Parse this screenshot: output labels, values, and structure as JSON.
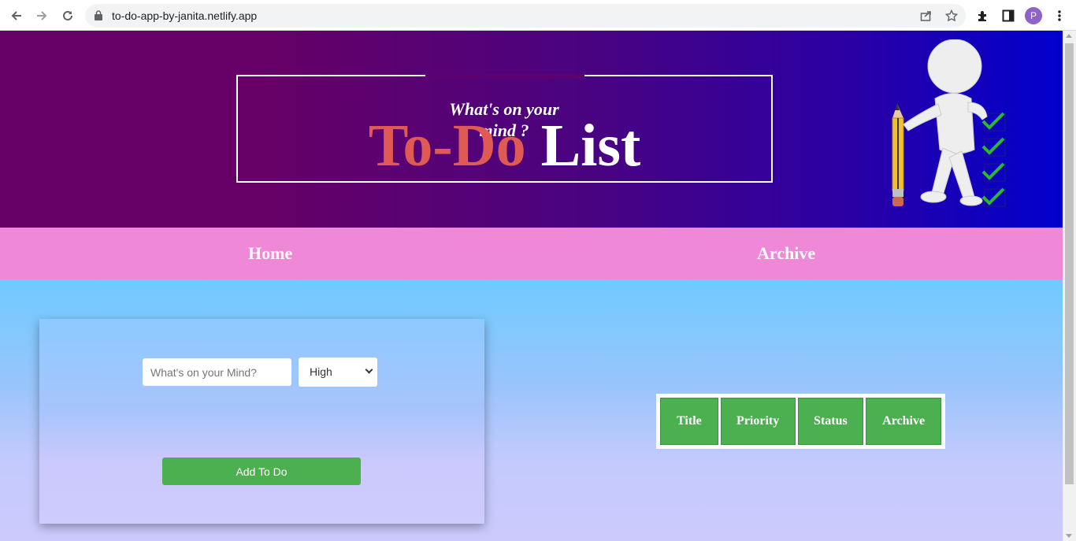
{
  "browser": {
    "url": "to-do-app-by-janita.netlify.app",
    "profile_initial": "P",
    "back_icon": "arrow-left-icon",
    "forward_icon": "arrow-right-icon",
    "reload_icon": "reload-icon"
  },
  "header": {
    "tagline_line1": "What's on your",
    "tagline_line2": "mind ?",
    "title_part1": "To-Do",
    "title_part2": "List",
    "colors": {
      "gradient_start": "#660066",
      "gradient_end": "#0000cc",
      "title_accent": "#e05a55"
    }
  },
  "nav": {
    "home_label": "Home",
    "archive_label": "Archive",
    "color": "#f088d8"
  },
  "form": {
    "task_placeholder": "What's on your Mind?",
    "priority_selected": "High",
    "add_button_label": "Add To Do",
    "button_color": "#4caf50"
  },
  "table": {
    "headers": [
      "Title",
      "Priority",
      "Status",
      "Archive"
    ]
  }
}
